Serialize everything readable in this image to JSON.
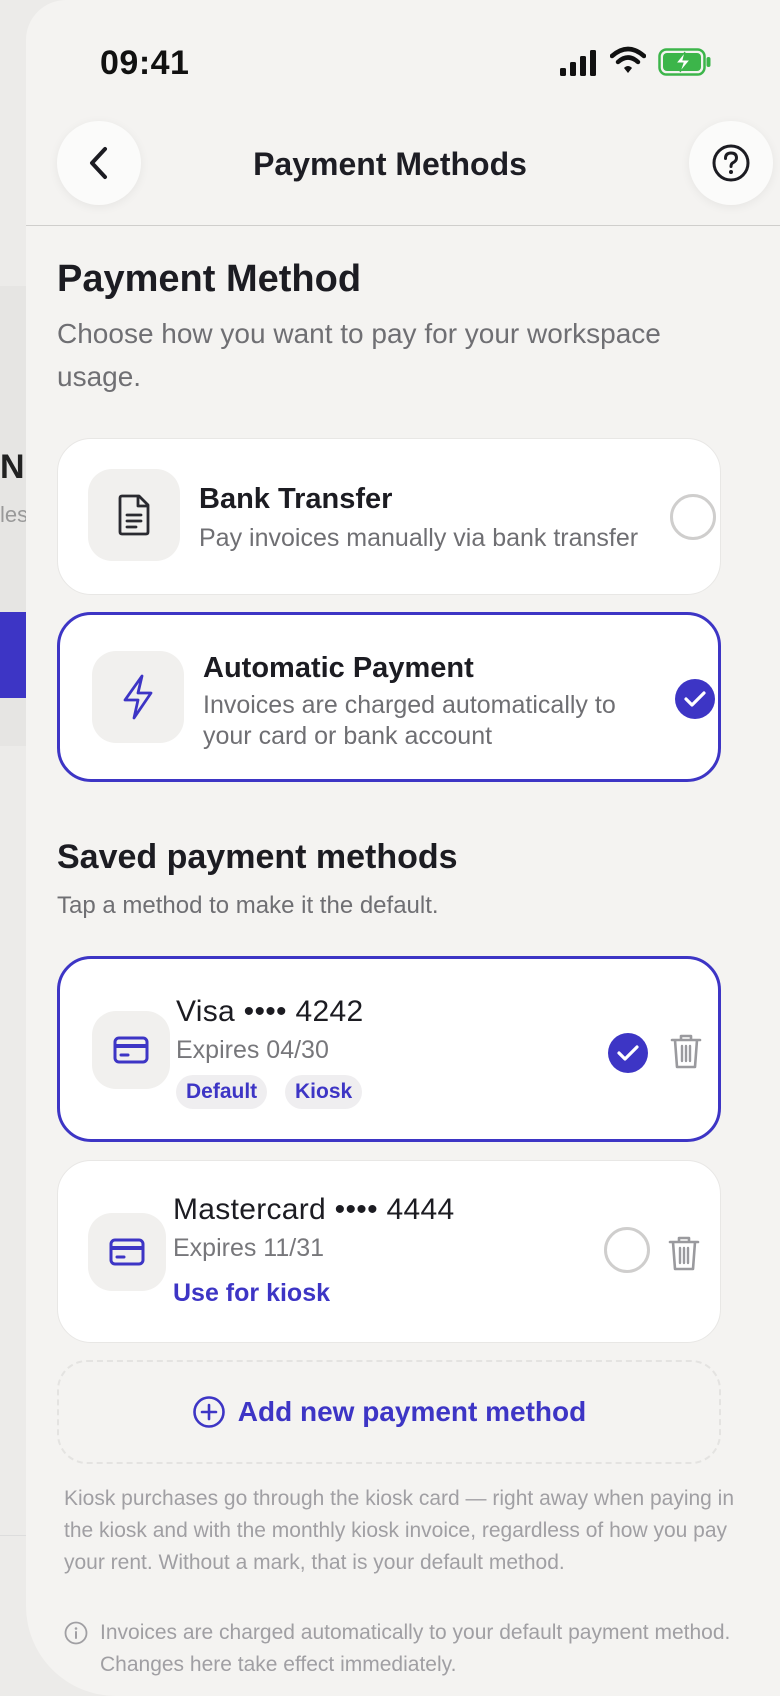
{
  "status_bar": {
    "time": "09:41"
  },
  "nav": {
    "title": "Payment Methods"
  },
  "header": {
    "title": "Payment Method",
    "subtitle": "Choose how you want to pay for your workspace usage."
  },
  "methods": [
    {
      "title": "Bank Transfer",
      "description": "Pay invoices manually via bank transfer",
      "selected": false,
      "icon": "document-icon"
    },
    {
      "title": "Automatic Payment",
      "description": "Invoices are charged automatically to your card or bank account",
      "selected": true,
      "icon": "lightning-icon"
    }
  ],
  "saved": {
    "title": "Saved payment methods",
    "subtitle": "Tap a method to make it the default.",
    "items": [
      {
        "name": "Visa •••• 4242",
        "expires": "Expires 04/30",
        "tags": [
          "Default",
          "Kiosk"
        ],
        "selected": true,
        "icon": "credit-card-icon"
      },
      {
        "name": "Mastercard •••• 4444",
        "expires": "Expires 11/31",
        "link": "Use for kiosk",
        "selected": false,
        "icon": "credit-card-icon"
      }
    ],
    "add_label": "Add new payment method"
  },
  "kiosk_note": "Kiosk purchases go through the kiosk card — right away when paying in the kiosk and with the monthly kiosk invoice, regardless of how you pay your rent. Without a mark, that is your default method.",
  "info_note": "Invoices are charged automatically to your default payment method. Changes here take effect immediately.",
  "colors": {
    "accent": "#3d35c5",
    "background": "#f4f3f1",
    "card": "#ffffff"
  },
  "background_page": {
    "letter": "N",
    "fragment": "les"
  }
}
